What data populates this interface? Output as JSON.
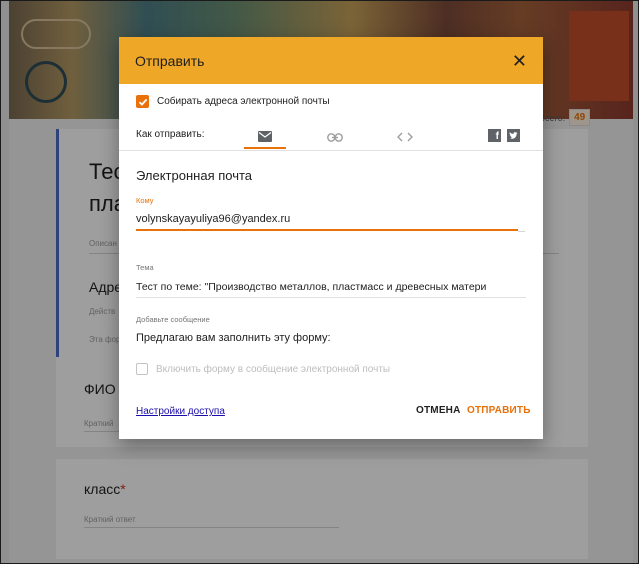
{
  "background": {
    "form_title_part1": "Тес",
    "form_title_part2": "пла",
    "form_description_hint": "Описан",
    "address_label": "Адре",
    "address_hint": "Действ",
    "address_hint2": "Эта фор",
    "fio_label": "ФИО",
    "fio_hint": "Краткий",
    "class_label": "класс",
    "required_mark": "*",
    "class_hint": "Краткий ответ",
    "total_label": "Всего:",
    "total_count": "49"
  },
  "dialog": {
    "title": "Отправить",
    "close_icon": "close-icon",
    "collect_emails_label": "Собирать адреса электронной почты",
    "collect_emails_checked": true,
    "send_method_label": "Как отправить:",
    "tabs": [
      {
        "icon": "email-icon",
        "active": true
      },
      {
        "icon": "link-icon",
        "active": false
      },
      {
        "icon": "embed-icon",
        "active": false
      }
    ],
    "share_icons": [
      "facebook-icon",
      "twitter-icon"
    ],
    "section_title": "Электронная почта",
    "to_label": "Кому",
    "to_value": "volynskayayuliya96@yandex.ru",
    "subject_label": "Тема",
    "subject_value": "Тест по теме: \"Производство металлов, пластмасс и древесных матери",
    "message_label": "Добавьте сообщение",
    "message_value": "Предлагаю вам заполнить эту форму:",
    "include_form_label": "Включить форму в сообщение электронной почты",
    "include_form_checked": false,
    "access_settings_link": "Настройки доступа",
    "cancel_button": "ОТМЕНА",
    "send_button": "ОТПРАВИТЬ"
  },
  "colors": {
    "header": "#eea727",
    "accent": "#e8710a",
    "link": "#1a0dab"
  }
}
